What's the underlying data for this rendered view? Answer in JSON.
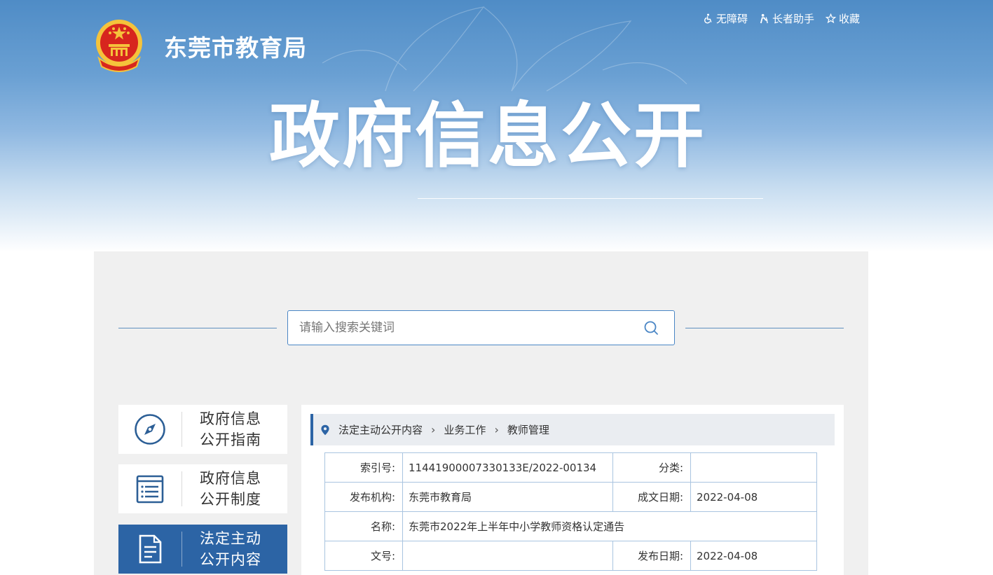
{
  "header": {
    "site_name": "东莞市教育局",
    "tools": [
      {
        "label": "无障碍",
        "icon": "wheelchair-icon"
      },
      {
        "label": "长者助手",
        "icon": "elder-helper-icon"
      },
      {
        "label": "收藏",
        "icon": "star-icon"
      }
    ],
    "banner_title": "政府信息公开"
  },
  "search": {
    "placeholder": "请输入搜索关键词"
  },
  "sidebar": {
    "items": [
      {
        "line1": "政府信息",
        "line2": "公开指南",
        "icon": "compass-icon",
        "active": false
      },
      {
        "line1": "政府信息",
        "line2": "公开制度",
        "icon": "document-list-icon",
        "active": false
      },
      {
        "line1": "法定主动",
        "line2": "公开内容",
        "icon": "file-text-icon",
        "active": true
      }
    ]
  },
  "breadcrumb": {
    "items": [
      "法定主动公开内容",
      "业务工作",
      "教师管理"
    ],
    "separator": "›"
  },
  "meta": {
    "index_label": "索引号:",
    "index_value": "11441900007330133E/2022-00134",
    "category_label": "分类:",
    "category_value": "",
    "publisher_label": "发布机构:",
    "publisher_value": "东莞市教育局",
    "written_date_label": "成文日期:",
    "written_date_value": "2022-04-08",
    "name_label": "名称:",
    "name_value": "东莞市2022年上半年中小学教师资格认定通告",
    "doc_no_label": "文号:",
    "doc_no_value": "",
    "publish_date_label": "发布日期:",
    "publish_date_value": "2022-04-08"
  },
  "colors": {
    "primary": "#2c64a5",
    "banner_top": "#4f8cc6",
    "panel_bg": "#f0f0f0",
    "table_border": "#a9c4e0"
  }
}
